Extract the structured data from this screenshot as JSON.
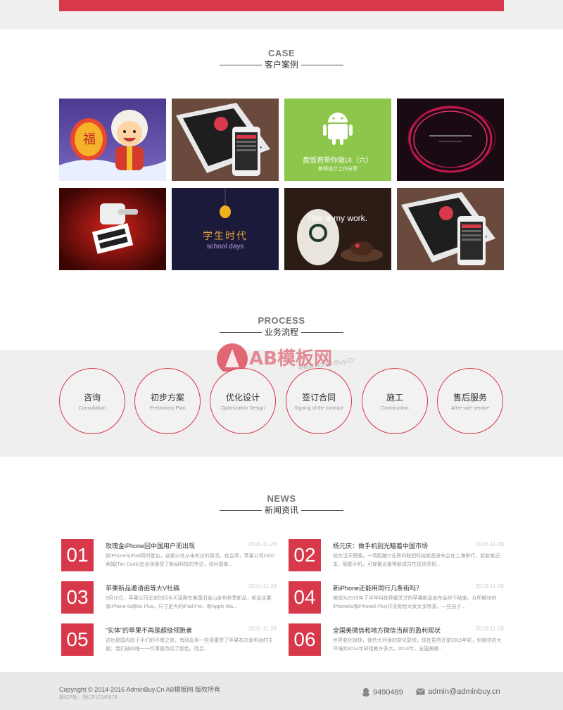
{
  "case": {
    "title_en": "CASE",
    "title_zh": "客户案例"
  },
  "case_items": [
    {
      "caption": ""
    },
    {
      "caption": ""
    },
    {
      "caption": "盘饭君带你做UI（六）",
      "sub": "移师设计工作分享"
    },
    {
      "caption": "",
      "sub": ""
    },
    {
      "caption": ""
    },
    {
      "caption": "学生时代",
      "sub": "school days"
    },
    {
      "caption": "This is my work."
    },
    {
      "caption": ""
    }
  ],
  "process": {
    "title_en": "PROCESS",
    "title_zh": "业务流程",
    "steps": [
      {
        "zh": "咨询",
        "en": "Consultation"
      },
      {
        "zh": "初步方案",
        "en": "Preliminary Plan"
      },
      {
        "zh": "优化设计",
        "en": "Optimization Design"
      },
      {
        "zh": "签订合同",
        "en": "Signing of the contract"
      },
      {
        "zh": "施工",
        "en": "Construction"
      },
      {
        "zh": "售后服务",
        "en": "After-sale service"
      }
    ]
  },
  "watermark": {
    "brand": "AB模板网",
    "url": "www.AdminBuy.Cn"
  },
  "news": {
    "title_en": "NEWS",
    "title_zh": "新闻资讯",
    "items": [
      {
        "num": "01",
        "title": "玫瑰金iPhone回中国用户而出现",
        "date": "2016-11-28",
        "excerpt": "新iPhone与iPad同时登台，这是以往从未有过的情况。在会场，苹果公司CEO蒂姆(Tim Cook)在会场接受了新闻科技的专访，询问图像..."
      },
      {
        "num": "02",
        "title": "杨元庆：做手机别光瞄着中国市场",
        "date": "2016-11-28",
        "excerpt": "就在当天傍晚，一场酝酿IT业界的联想科技新品发布会在上海举行，新款笔记本、智能手机、可穿戴设备等新成员在现场亮相..."
      },
      {
        "num": "03",
        "title": "苹果新品邀请函等大V社稿",
        "date": "2016-11-28",
        "excerpt": "9月10日，苹果公司北京时间今天凌晨在美国旧金山发布秋季新品，新品主要有iPhone 6s和6s Plus、尺寸更大的iPad Pro、新Apple Wa..."
      },
      {
        "num": "04",
        "title": "新iPhone还能用同行几条街吗？",
        "date": "2016-11-28",
        "excerpt": "被视为2015年下半年科技界最关注的苹果新品发布会终于结束。众所期待的iPhone6s和iPhone6 Plus并没有给大家太多惊喜，一些由于..."
      },
      {
        "num": "05",
        "title": "“实体”的苹果不再是超级领跑者",
        "date": "2016-11-28",
        "excerpt": "这也是国内起子手们的不眠之夜，有网友用一些语惠赞了苹果本次发布会的主题：我们缺的唯一一件事是改动了颜色。而且..."
      },
      {
        "num": "06",
        "title": "全国美微信和地方微信当前的盈利现状",
        "date": "2016-11-28",
        "excerpt": "世界变化很快，微信大环境的变化更快。现在虽然还是2015年初，但微信的大环境和2014年却相差许多大。2014年，全国美微..."
      }
    ]
  },
  "footer": {
    "copyright": "Copyright © 2014-2016 AdminBuy.Cn AB模板网 版权所有",
    "icp": "蒙ICP备：浙ICP12345678",
    "qq": "9490489",
    "email": "admin@adminbuy.cn"
  },
  "colors": {
    "accent": "#d8394a",
    "band": "#efefef"
  }
}
